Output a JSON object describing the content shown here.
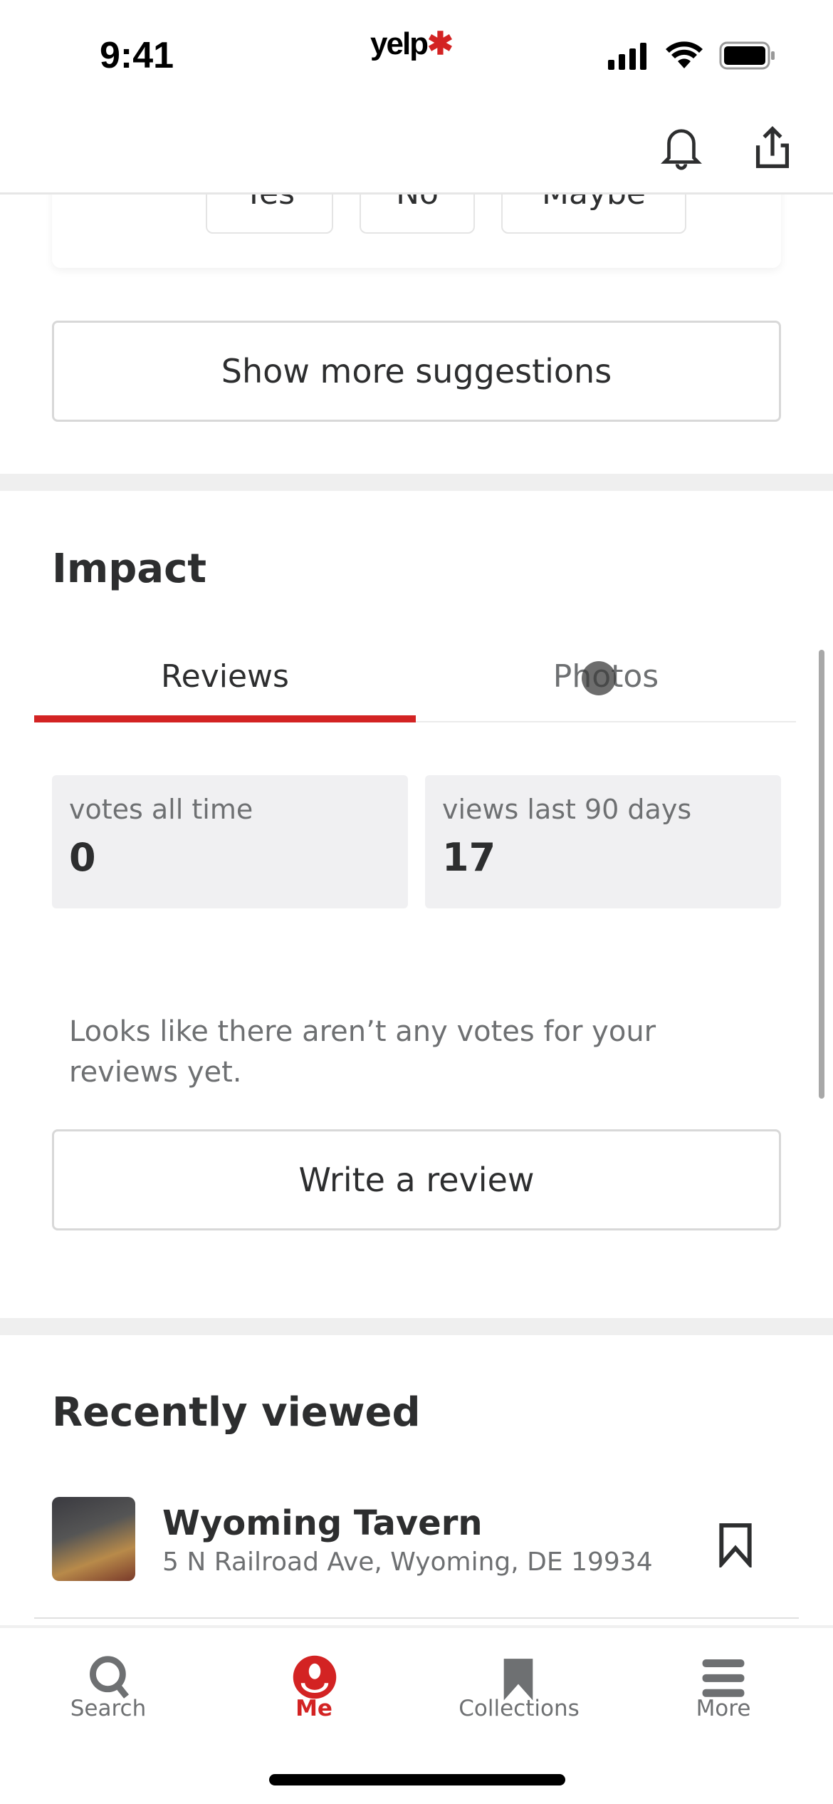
{
  "status_bar": {
    "time": "9:41",
    "logo": "yelp"
  },
  "header": {
    "icons": [
      "bell-icon",
      "share-icon"
    ]
  },
  "suggestion_card": {
    "answers": [
      "Yes",
      "No",
      "Maybe"
    ]
  },
  "show_more_label": "Show more suggestions",
  "impact": {
    "title": "Impact",
    "tabs": [
      {
        "label": "Reviews",
        "active": true
      },
      {
        "label": "Photos",
        "active": false
      }
    ],
    "stats": [
      {
        "label": "votes all time",
        "value": "0"
      },
      {
        "label": "views last 90 days",
        "value": "17"
      }
    ],
    "empty_message": "Looks like there aren’t any votes for your reviews yet.",
    "write_review_label": "Write a review"
  },
  "recently_viewed": {
    "title": "Recently viewed",
    "items": [
      {
        "name": "Wyoming Tavern",
        "address": "5 N Railroad Ave, Wyoming, DE 19934"
      }
    ]
  },
  "bottom_nav": {
    "items": [
      {
        "label": "Search",
        "icon": "search-icon"
      },
      {
        "label": "Me",
        "icon": "user-icon",
        "active": true
      },
      {
        "label": "Collections",
        "icon": "bookmark-icon"
      },
      {
        "label": "More",
        "icon": "menu-icon"
      }
    ]
  },
  "colors": {
    "accent": "#d32323",
    "text": "#2d2e2f",
    "muted": "#6e7072"
  }
}
